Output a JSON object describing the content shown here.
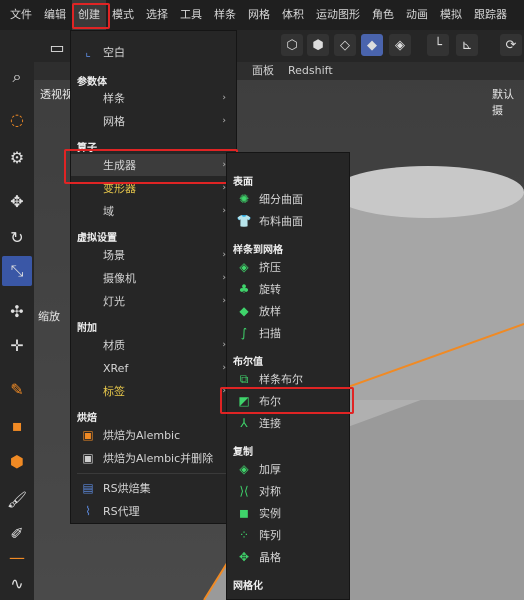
{
  "menubar": [
    "文件",
    "编辑",
    "创建",
    "模式",
    "选择",
    "工具",
    "样条",
    "网格",
    "体积",
    "运动图形",
    "角色",
    "动画",
    "模拟",
    "跟踪器"
  ],
  "viewport": {
    "tabs": [
      "面板",
      "Redshift"
    ],
    "label_left": "透视视",
    "label_right": "默认摄",
    "zoom_label": "缩放"
  },
  "menu1": {
    "empty": "空白",
    "h_param": "参数体",
    "spline": "样条",
    "mesh": "网格",
    "h_sub": "算子",
    "generator": "生成器",
    "deformer": "变形器",
    "field": "域",
    "h_virtual": "虚拟设置",
    "scene": "场景",
    "camera": "摄像机",
    "light": "灯光",
    "h_add": "附加",
    "material": "材质",
    "xref": "XRef",
    "tag": "标签",
    "h_bake": "烘焙",
    "bake_alembic": "烘焙为Alembic",
    "bake_alembic_del": "烘焙为Alembic并删除",
    "rs_bake": "RS烘焙集",
    "rs_proxy": "RS代理"
  },
  "menu2": {
    "h_surface": "表面",
    "subdiv": "细分曲面",
    "cloth": "布料曲面",
    "h_spline_mesh": "样条到网格",
    "extrude": "挤压",
    "lathe": "旋转",
    "loft": "放样",
    "sweep": "扫描",
    "h_boole": "布尔值",
    "spline_boole": "样条布尔",
    "boole": "布尔",
    "connect": "连接",
    "h_copy": "复制",
    "thicken": "加厚",
    "symmetry": "对称",
    "instance": "实例",
    "array": "阵列",
    "lattice": "晶格",
    "h_mesh": "网格化"
  }
}
